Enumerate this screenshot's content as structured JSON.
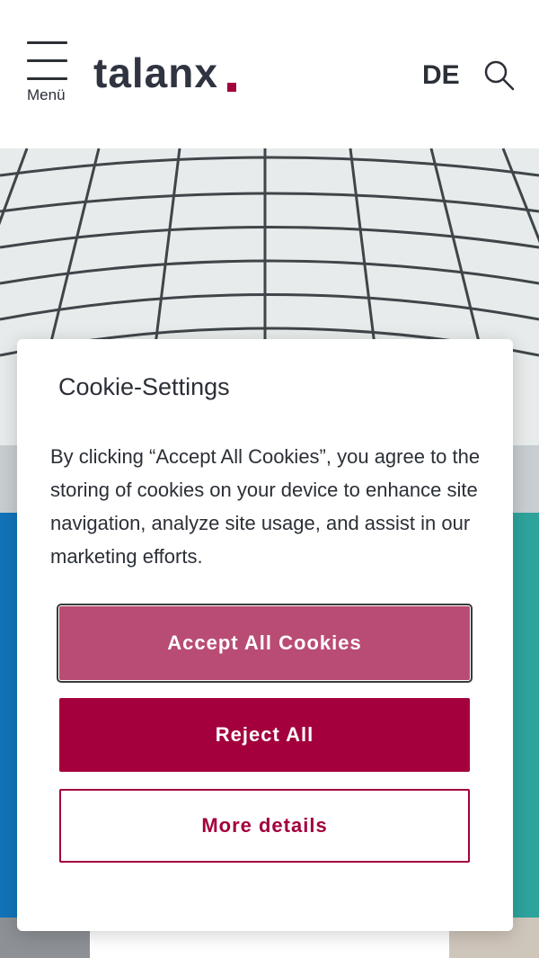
{
  "header": {
    "menu_label": "Menü",
    "logo_text": "talanx",
    "language": "DE",
    "brand_color": "#a3003d",
    "icons": {
      "menu": "hamburger-icon",
      "search": "search-icon"
    }
  },
  "cookie_dialog": {
    "title": "Cookie-Settings",
    "text": "By clicking “Accept All Cookies”, you agree to the storing of cookies on your device to enhance site navigation, analyze site usage, and assist in our marketing efforts.",
    "accept_label": "Accept All Cookies",
    "reject_label": "Reject All",
    "details_label": "More details",
    "colors": {
      "accept": "#b94c74",
      "reject": "#a3003d",
      "details_border": "#a3003d"
    }
  }
}
